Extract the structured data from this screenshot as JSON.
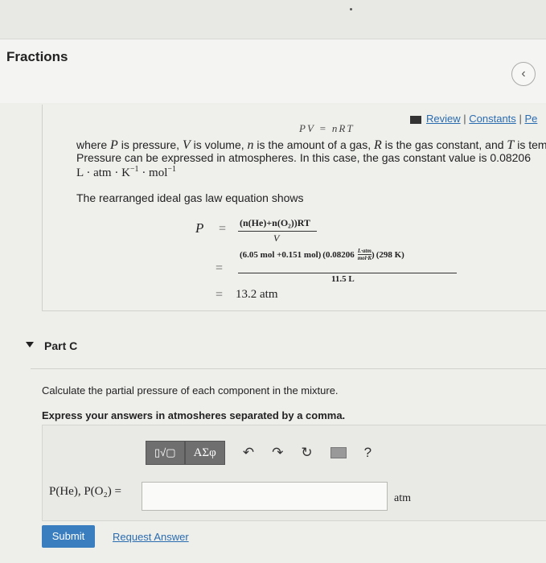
{
  "header": {
    "title": "Fractions",
    "back_icon": "chevron-left-icon"
  },
  "links": {
    "review": "Review",
    "separator": "|",
    "constants": "Constants",
    "periodic": "Pe"
  },
  "intro": {
    "ideal_gas_top": "PV = nRT",
    "line1_a": "where ",
    "line1_P": "P",
    "line1_b": " is pressure, ",
    "line1_V": "V",
    "line1_c": " is volume, ",
    "line1_n": "n",
    "line1_d": " is the amount of a gas, ",
    "line1_R": "R",
    "line1_e": " is the gas constant, and ",
    "line1_T": "T",
    "line1_f": " is tempe",
    "line2": "Pressure can be expressed in atmospheres. In this case, the gas constant value is 0.08206",
    "line3": "L · atm · K",
    "line3_exp1": "−1",
    "line3_mid": " · mol",
    "line3_exp2": "−1",
    "line4": "The rearranged ideal gas law equation shows"
  },
  "equation": {
    "lhs": "P",
    "eq1": "=",
    "frac1_num": "(n(He)+n(O₂))RT",
    "frac1_den": "V",
    "eq2": "=",
    "frac2_num_a": "(6.05 mol +0.151 mol)",
    "frac2_num_b": "(0.08206",
    "frac2_unit_num": "L·atm",
    "frac2_unit_den": "mol·K",
    "frac2_num_c": ")",
    "frac2_num_d": "(298 K)",
    "frac2_den": "11.5 L",
    "eq3": "=",
    "result": "13.2 atm"
  },
  "partc": {
    "label": "Part C",
    "question": "Calculate the partial pressure of each component in the mixture.",
    "instruction": "Express your answers in atmosheres separated by a comma."
  },
  "toolbar": {
    "template_label": "▯√▢",
    "symbol_label": "ΑΣφ",
    "undo": "↶",
    "redo": "↷",
    "reset": "↻",
    "keyboard_icon": "keyboard-icon",
    "help": "?"
  },
  "answer": {
    "label": "P(He), P(O₂) =",
    "value": "",
    "unit": "atm"
  },
  "buttons": {
    "submit": "Submit",
    "request": "Request Answer"
  }
}
